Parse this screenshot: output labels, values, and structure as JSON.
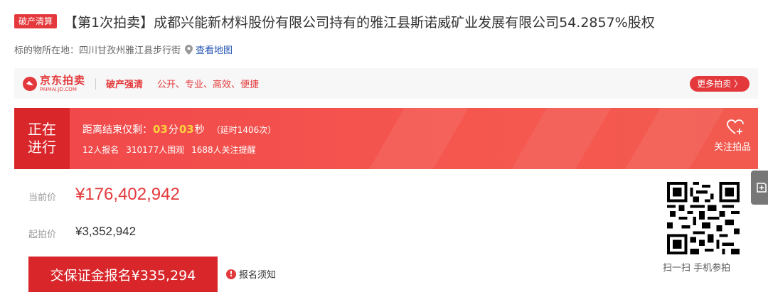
{
  "header": {
    "tag": "破产清算",
    "title": "【第1次拍卖】成都兴能新材料股份有限公司持有的雅江县斯诺威矿业发展有限公司54.2857%股权"
  },
  "location": {
    "label": "标的物所在地：四川甘孜州雅江县步行街",
    "map_link": "查看地图"
  },
  "brand_bar": {
    "logo_cn": "京东拍卖",
    "logo_en": "PAIMAI.JD.COM",
    "tag": "破产强清",
    "slogan": "公开、专业、高效、便捷",
    "more_button": "更多拍卖 〉"
  },
  "status": {
    "state_line1": "正在",
    "state_line2": "进行",
    "countdown_prefix": "距离结束仅剩：",
    "minutes": "03",
    "minutes_unit": "分",
    "seconds": "03",
    "seconds_unit": "秒",
    "extension": "（延时1406次）",
    "registrations": "12人报名",
    "views": "310177人围观",
    "reminders": "1688人关注提醒",
    "follow_label": "关注拍品"
  },
  "prices": {
    "current_label": "当前价",
    "current_value": "¥176,402,942",
    "start_label": "起拍价",
    "start_value": "¥3,352,942"
  },
  "actions": {
    "bid_button": "交保证金报名¥335,294",
    "notice_icon": "!",
    "notice_link": "报名须知"
  },
  "qr": {
    "caption": "扫一扫 手机参拍"
  },
  "colors": {
    "brand_red": "#e4393c",
    "dark_red": "#d8262a",
    "countdown_yellow": "#ffd23f",
    "link_blue": "#2053b3"
  }
}
